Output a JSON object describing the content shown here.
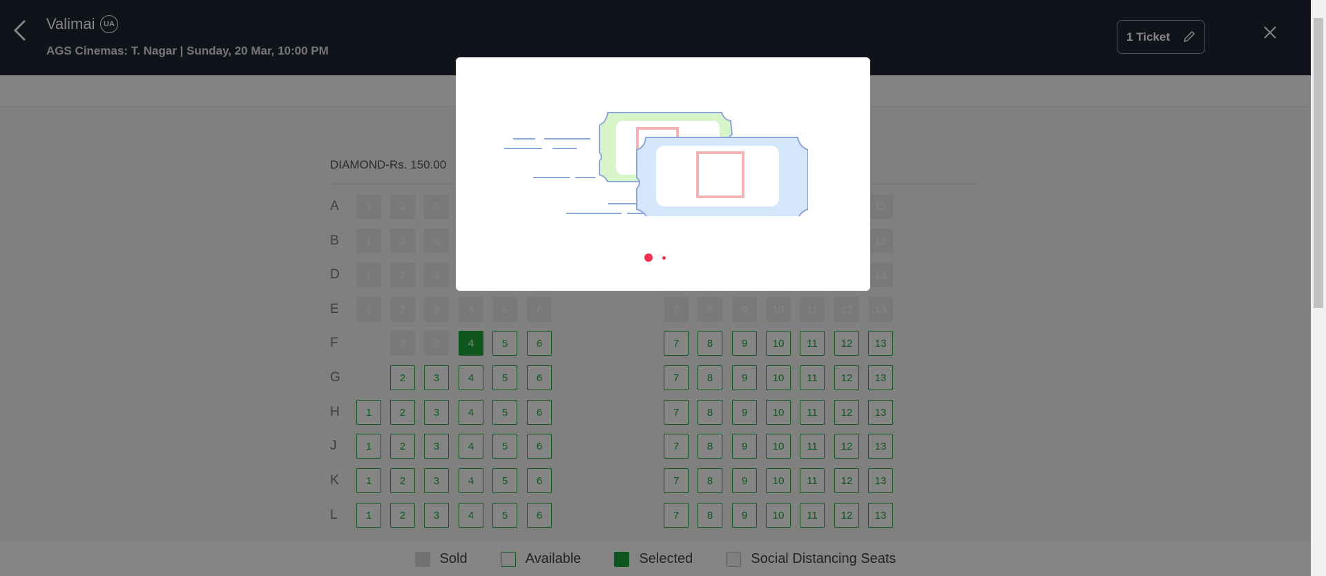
{
  "header": {
    "movie_title": "Valimai",
    "certificate": "UA",
    "venue_line": "AGS Cinemas: T. Nagar | Sunday, 20 Mar, 10:00 PM",
    "ticket_button": "1 Ticket"
  },
  "section": {
    "title": "DIAMOND-Rs. 150.00"
  },
  "rows": [
    "A",
    "B",
    "D",
    "E",
    "F",
    "G",
    "H",
    "J",
    "K",
    "L"
  ],
  "seat_status": {
    "A": "sold",
    "B": "sold",
    "D": "sold",
    "E": "sold",
    "F": "available (F1 missing, F2-F3 sold, F4 selected)",
    "G": "available (no seat 1)",
    "H": "available",
    "J": "available",
    "K": "available",
    "L": "available"
  },
  "selected_seat": "F4",
  "legend": {
    "sold": "Sold",
    "available": "Available",
    "selected": "Selected",
    "social": "Social Distancing Seats"
  },
  "colors": {
    "header_bg": "#1f2533",
    "available": "#1ea83c",
    "selected": "#1ea83c",
    "loader_dot": "#f1304f"
  },
  "icons": {
    "back": "chevron-left-icon",
    "edit": "pencil-icon",
    "close": "close-icon"
  }
}
